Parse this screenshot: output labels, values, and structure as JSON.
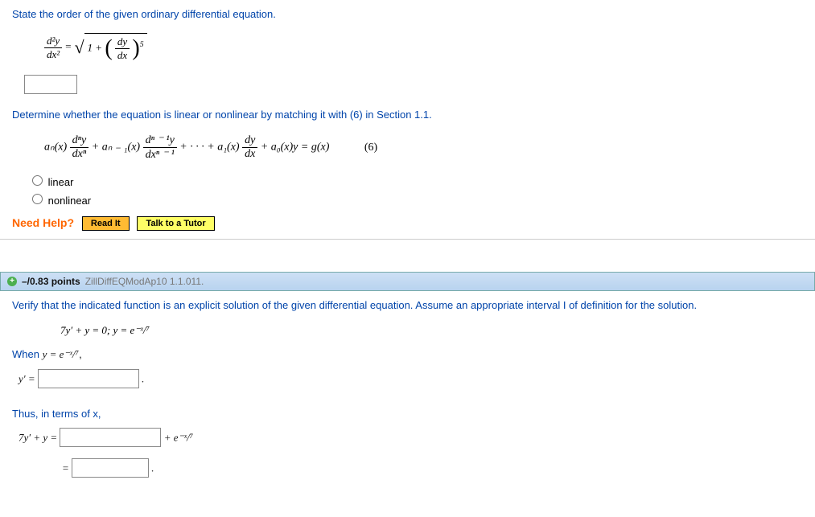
{
  "q1": {
    "prompt1": "State the order of the given ordinary differential equation.",
    "eq1_lhs_num": "d²y",
    "eq1_lhs_den": "dx²",
    "eq1_eq": " = ",
    "eq1_sqrt_inner_a": "1 + ",
    "eq1_frac2_num": "dy",
    "eq1_frac2_den": "dx",
    "eq1_exp": "5",
    "prompt2": "Determine whether the equation is linear or nonlinear by matching it with (6) in Section 1.1.",
    "eq2_a": "aₙ(x)",
    "eq2_f1_num": "dⁿy",
    "eq2_f1_den": "dxⁿ",
    "eq2_b": " + aₙ ₋ ₁(x)",
    "eq2_f2_num": "dⁿ ⁻ ¹y",
    "eq2_f2_den": "dxⁿ ⁻ ¹",
    "eq2_c": " + · · · + a₁(x)",
    "eq2_f3_num": "dy",
    "eq2_f3_den": "dx",
    "eq2_d": " + a₀(x)y = g(x)",
    "eq2_tag": "(6)",
    "opt_linear": "linear",
    "opt_nonlinear": "nonlinear",
    "need_help": "Need Help?",
    "read_it": "Read It",
    "talk_tutor": "Talk to a Tutor"
  },
  "hdr": {
    "points": "–/0.83 points",
    "ref": "ZillDiffEQModAp10 1.1.011."
  },
  "q2": {
    "prompt": "Verify that the indicated function is an explicit solution of the given differential equation. Assume an appropriate interval I of definition for the solution.",
    "eq_given": "7y′ + y = 0;    y = e⁻ˣ/⁷",
    "when_a": "When  ",
    "when_b": "y = e⁻ˣ/⁷",
    "when_c": ",",
    "ypr": "y′ = ",
    "dot": ".",
    "thus": "Thus, in terms of x,",
    "line2_lhs": "7y′ + y = ",
    "line2_rhs": " + e⁻ˣ/⁷",
    "line3_lhs": "= "
  }
}
